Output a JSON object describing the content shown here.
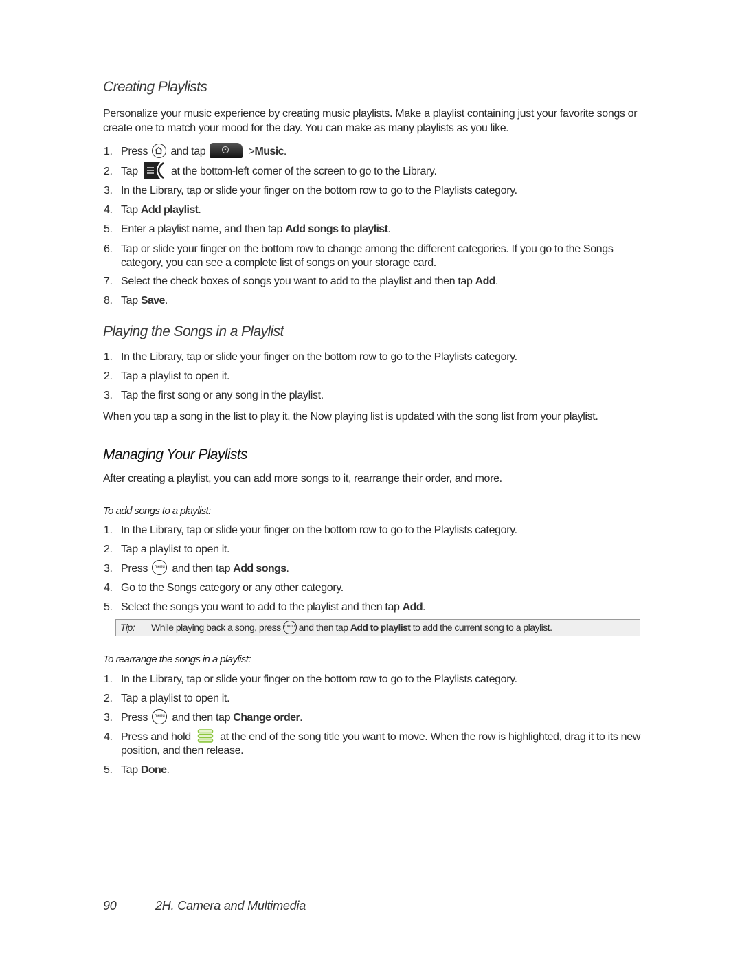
{
  "sections": {
    "creating": {
      "title": "Creating Playlists",
      "intro": "Personalize your music experience by creating music playlists. Make a playlist containing just your favorite songs or create one to match your mood for the day. You can make as many playlists as you like.",
      "steps": [
        {
          "num": "1.",
          "pre": "Press",
          "mid": "and tap",
          "sep": ">",
          "bold": "Music",
          "post": "."
        },
        {
          "num": "2.",
          "pre": "Tap",
          "post": "at the bottom-left corner of the screen to go to the Library."
        },
        {
          "num": "3.",
          "text": "In the Library, tap or slide your finger on the bottom row to go to the Playlists category."
        },
        {
          "num": "4.",
          "pre": "Tap",
          "bold": "Add playlist",
          "post": "."
        },
        {
          "num": "5.",
          "pre": "Enter a playlist name, and then tap",
          "bold": "Add songs to playlist",
          "post": "."
        },
        {
          "num": "6.",
          "text": "Tap or slide your finger on the bottom row to change among the different categories. If you go to the Songs category, you can see a complete list of songs on your storage card."
        },
        {
          "num": "7.",
          "pre": "Select the check boxes of songs you want to add to the playlist and then tap",
          "bold": "Add",
          "post": "."
        },
        {
          "num": "8.",
          "pre": "Tap",
          "bold": "Save",
          "post": "."
        }
      ]
    },
    "playing": {
      "title": "Playing the Songs in a Playlist",
      "steps": [
        {
          "num": "1.",
          "text": "In the Library, tap or slide your finger on the bottom row to go to the Playlists category."
        },
        {
          "num": "2.",
          "text": "Tap a playlist to open it."
        },
        {
          "num": "3.",
          "text": "Tap the first song or any song in the playlist."
        }
      ],
      "note": "When you tap a song in the list to play it, the Now playing list is updated with the song list from your playlist."
    },
    "managing": {
      "title": "Managing Your Playlists",
      "intro": "After creating a playlist, you can add more songs to it, rearrange their order, and more.",
      "add_songs": {
        "title": "To add songs to a playlist:",
        "steps": [
          {
            "num": "1.",
            "text": "In the Library, tap or slide your finger on the bottom row to go to the Playlists category."
          },
          {
            "num": "2.",
            "text": "Tap a playlist to open it."
          },
          {
            "num": "3.",
            "pre": "Press",
            "mid": "and then tap",
            "bold": "Add songs",
            "post": "."
          },
          {
            "num": "4.",
            "text": "Go to the Songs category or any other category."
          },
          {
            "num": "5.",
            "pre": "Select the songs you want to add to the playlist and then tap",
            "bold": "Add",
            "post": "."
          }
        ]
      },
      "tip": {
        "label": "Tip:",
        "pre": "While playing back a song, press",
        "mid": "and then tap",
        "bold": "Add to playlist",
        "post": "to add the current song to a playlist."
      },
      "rearrange": {
        "title": "To rearrange the songs in a playlist:",
        "steps": [
          {
            "num": "1.",
            "text": "In the Library, tap or slide your finger on the bottom row to go to the Playlists category."
          },
          {
            "num": "2.",
            "text": "Tap a playlist to open it."
          },
          {
            "num": "3.",
            "pre": "Press",
            "mid": "and then tap",
            "bold": "Change order",
            "post": "."
          },
          {
            "num": "4.",
            "pre": "Press and hold",
            "post": "at the end of the song title you want to move. When the row is highlighted, drag it to its new position, and then release."
          },
          {
            "num": "5.",
            "pre": "Tap",
            "bold": "Done",
            "post": "."
          }
        ]
      }
    }
  },
  "icons": {
    "menu_label": "menu",
    "home": "home-icon",
    "launcher": "launcher-tab-icon",
    "library": "library-icon",
    "drag": "drag-handle-icon",
    "drag_color": "#8cc63f"
  },
  "footer": {
    "page_number": "90",
    "chapter": "2H. Camera and Multimedia"
  }
}
